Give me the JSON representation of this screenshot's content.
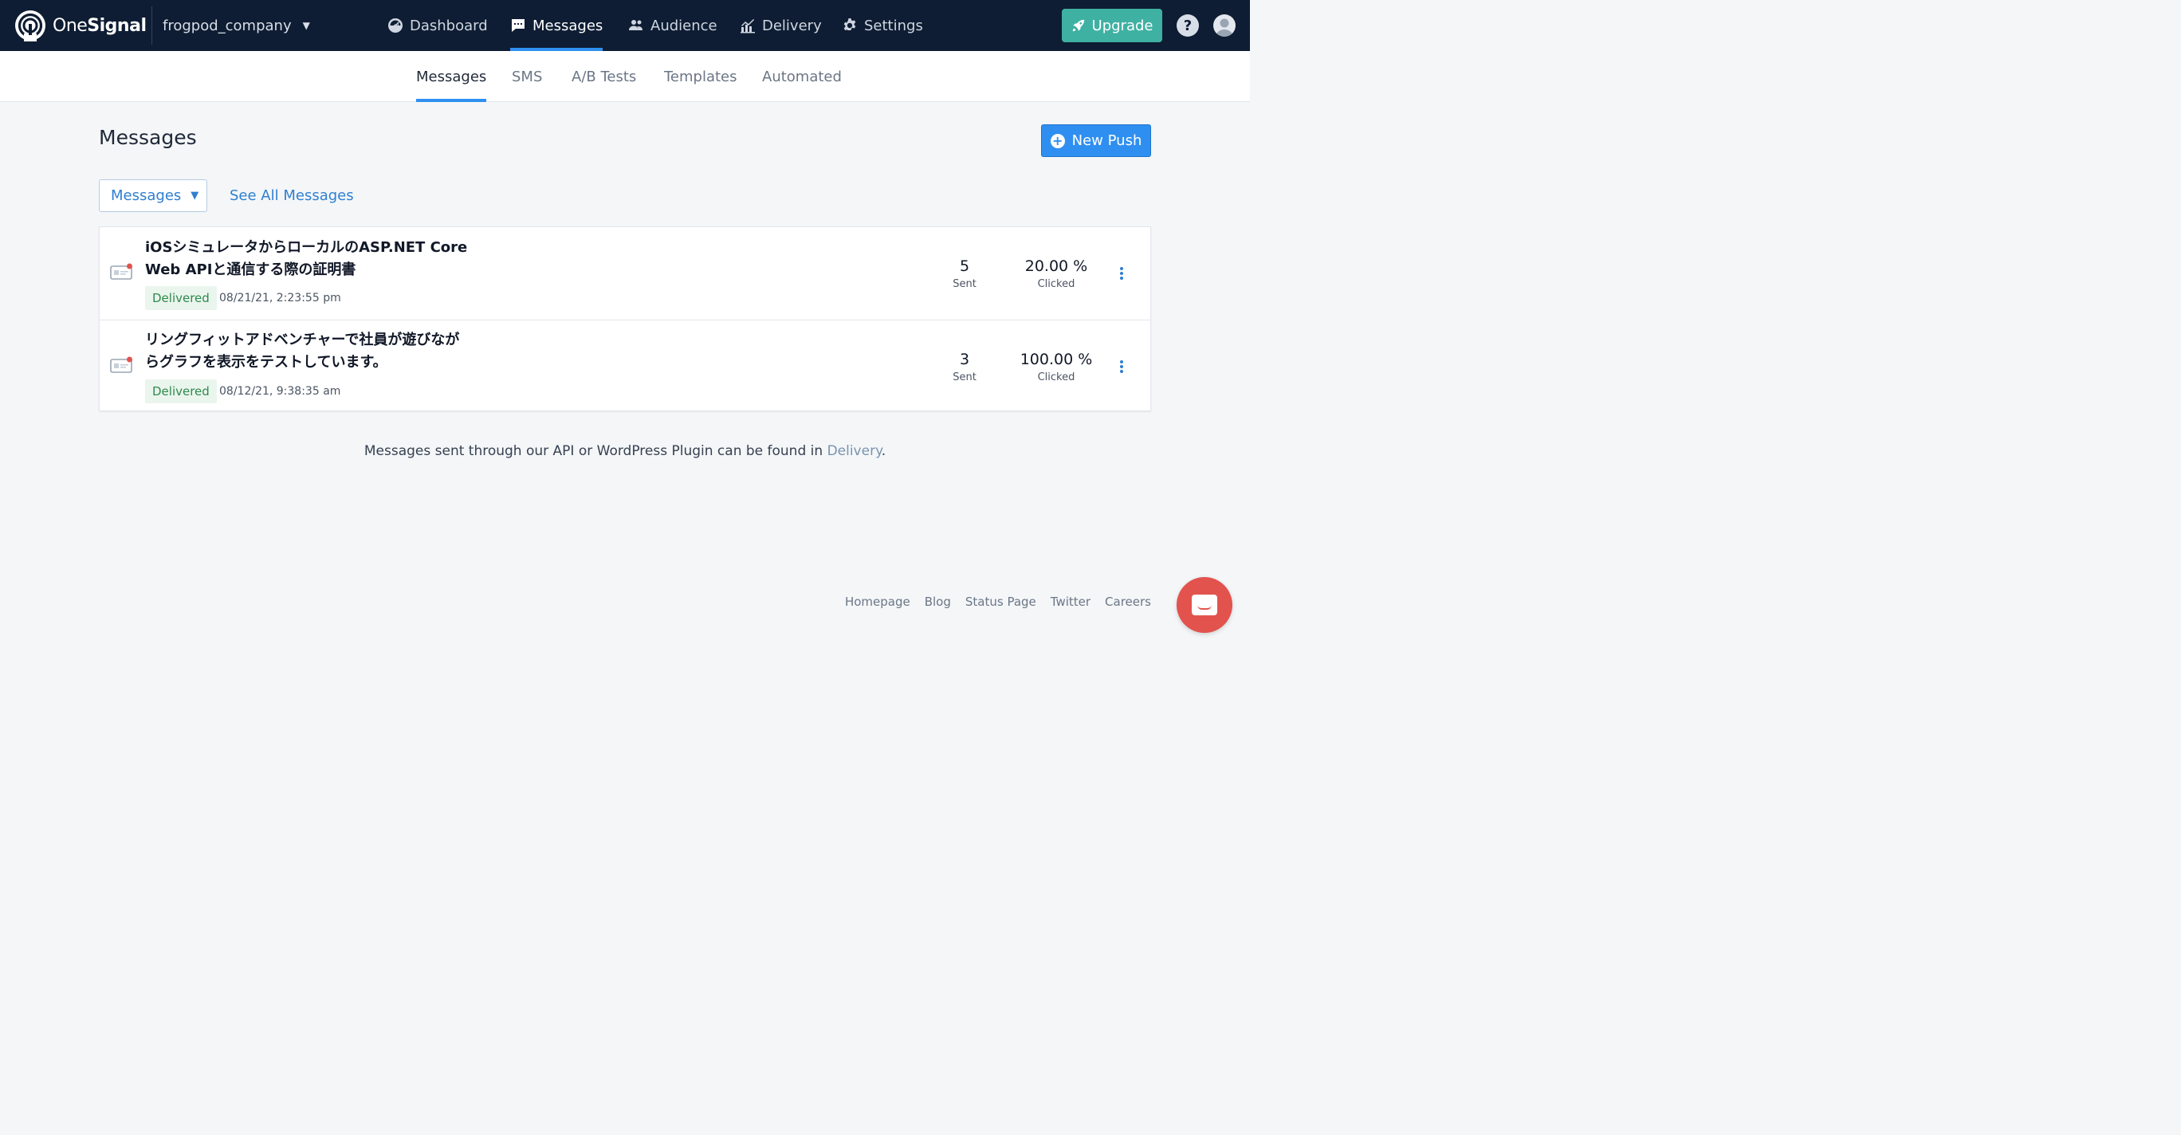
{
  "brand": {
    "logo_text_light": "One",
    "logo_text_bold": "Signal",
    "accent": "#2f8ff0",
    "nav_bg": "#0e1d33"
  },
  "app": {
    "name": "frogpod_company"
  },
  "topnav": [
    {
      "label": "Dashboard",
      "icon": "dashboard-icon"
    },
    {
      "label": "Messages",
      "icon": "message-icon",
      "active": true
    },
    {
      "label": "Audience",
      "icon": "audience-icon"
    },
    {
      "label": "Delivery",
      "icon": "delivery-icon"
    },
    {
      "label": "Settings",
      "icon": "gear-icon"
    }
  ],
  "upgrade_label": "Upgrade",
  "help_label": "?",
  "subnav": [
    {
      "label": "Messages",
      "active": true
    },
    {
      "label": "SMS"
    },
    {
      "label": "A/B Tests"
    },
    {
      "label": "Templates"
    },
    {
      "label": "Automated"
    }
  ],
  "page": {
    "title": "Messages",
    "new_push_label": "New Push",
    "filter_label": "Messages",
    "see_all_label": "See All Messages"
  },
  "messages": [
    {
      "title_line1": "iOSシミュレータからローカルのASP.NET Core",
      "title_line2": "Web APIと通信する際の証明書",
      "status": "Delivered",
      "date": "08/21/21, 2:23:55 pm",
      "sent": "5",
      "sent_label": "Sent",
      "clicked": "20.00 %",
      "clicked_label": "Clicked"
    },
    {
      "title_line1": "リングフィットアドベンチャーで社員が遊びなが",
      "title_line2": "らグラフを表示をテストしています。",
      "status": "Delivered",
      "date": "08/12/21, 9:38:35 am",
      "sent": "3",
      "sent_label": "Sent",
      "clicked": "100.00 %",
      "clicked_label": "Clicked"
    }
  ],
  "footnote": {
    "text": "Messages sent through our API or WordPress Plugin can be found in ",
    "link": "Delivery",
    "end": "."
  },
  "footer_links": [
    "Homepage",
    "Blog",
    "Status Page",
    "Twitter",
    "Careers"
  ]
}
